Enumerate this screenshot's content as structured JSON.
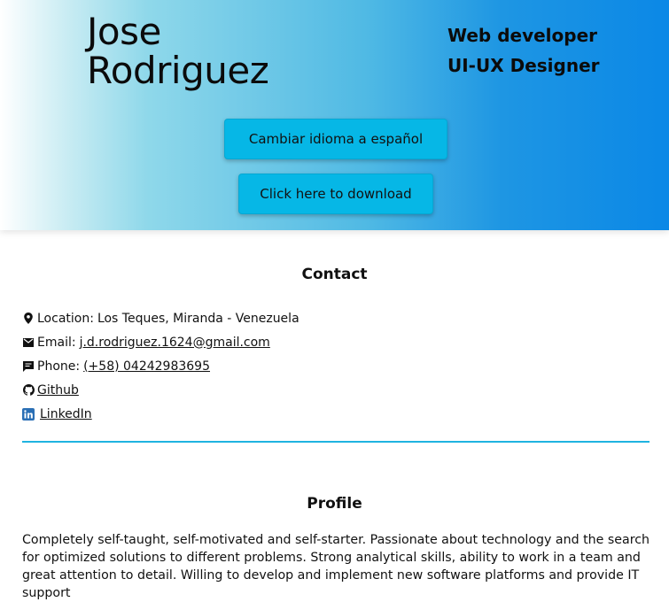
{
  "header": {
    "name_first": "Jose",
    "name_last": "Rodriguez",
    "roles": [
      "Web developer",
      "UI-UX Designer"
    ],
    "language_button": "Cambiar idioma a español",
    "download_button": "Click here to download"
  },
  "contact": {
    "title": "Contact",
    "location_label": "Location:",
    "location_value": "Los Teques, Miranda - Venezuela",
    "email_label": "Email:",
    "email_value": "j.d.rodriguez.1624@gmail.com",
    "phone_label": "Phone:",
    "phone_value": "(+58) 04242983695",
    "github": "Github",
    "linkedin": "LinkedIn"
  },
  "profile": {
    "title": "Profile",
    "text": "Completely self-taught, self-motivated and self-starter. Passionate about technology and the search for optimized solutions to different problems. Strong analytical skills, ability to work in a team and great attention to detail. Willing to develop and implement new software platforms and provide IT support"
  },
  "colors": {
    "accent": "#06b7e6",
    "divider": "#1fb3e0",
    "header_gradient_end": "#0b88e6"
  }
}
